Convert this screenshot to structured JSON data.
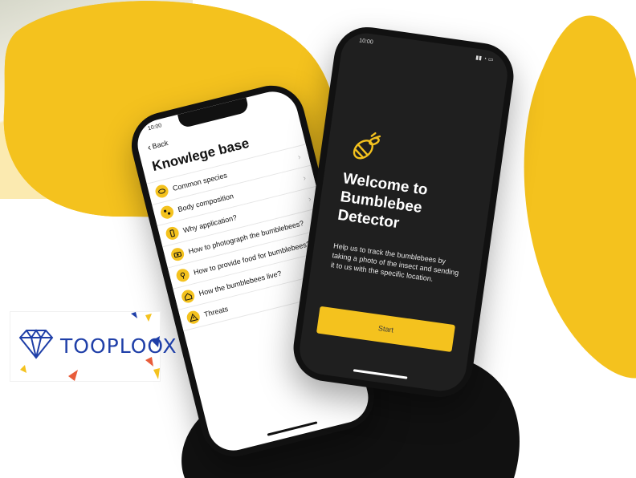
{
  "colors": {
    "brand_yellow": "#f4c21e",
    "dark_screen": "#1f1f1f",
    "phone_frame": "#111111",
    "logo_blue": "#1f3fa8"
  },
  "logo": {
    "text": "TOOPLOOX",
    "icon": "diamond-logo-icon"
  },
  "knowledge_phone": {
    "status_time": "10:00",
    "back_label": "Back",
    "title": "Knowlege base",
    "items": [
      {
        "label": "Common species",
        "icon": "bee-species-icon"
      },
      {
        "label": "Body composition",
        "icon": "body-icon"
      },
      {
        "label": "Why application?",
        "icon": "phone-icon"
      },
      {
        "label": "How to photograph the bumblebees?",
        "icon": "camera-icon"
      },
      {
        "label": "How to provide food for bumblebees?",
        "icon": "flower-icon"
      },
      {
        "label": "How the bumblebees live?",
        "icon": "house-icon"
      },
      {
        "label": "Threats",
        "icon": "warning-icon"
      }
    ]
  },
  "welcome_phone": {
    "status_time": "10:00",
    "heading_lines": [
      "Welcome to",
      "Bumblebee",
      "Detector"
    ],
    "description": "Help us to track the bumblebees by taking a photo of the insect and sending it to us with the specific location.",
    "start_label": "Start",
    "icon": "bee-icon"
  }
}
